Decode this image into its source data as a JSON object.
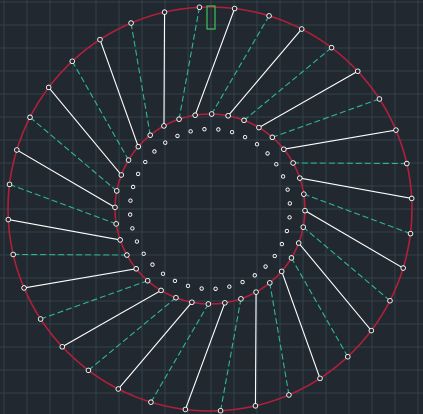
{
  "colors": {
    "background": "#212830",
    "grid": "#34404a",
    "circle": "#b0203a",
    "solid_line": "#ffffff",
    "dashed_line": "#2fb79a",
    "marker_stroke": "#ffffff",
    "green_marker": "#3cc45a"
  },
  "drawing": {
    "outer_circle_marks": 36,
    "inner_circle_marks": 36,
    "small_circle_marks": 36,
    "line_types": [
      "solid",
      "dashed"
    ]
  }
}
